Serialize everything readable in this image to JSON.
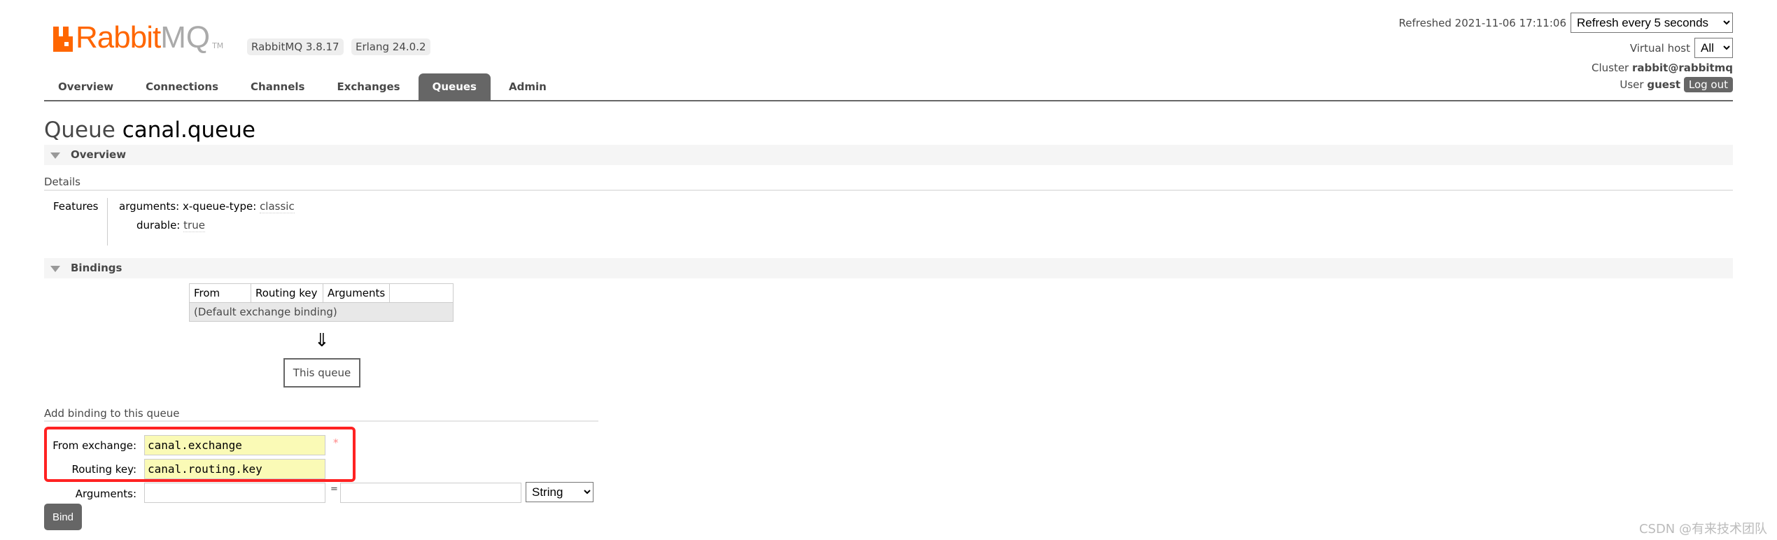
{
  "header": {
    "logo_text": "RabbitMQ",
    "versions": [
      "RabbitMQ 3.8.17",
      "Erlang 24.0.2"
    ],
    "refreshed": "Refreshed 2021-11-06 17:11:06",
    "refresh_select": "Refresh every 5 seconds",
    "vhost_label": "Virtual host",
    "vhost_value": "All",
    "cluster_label": "Cluster",
    "cluster_value": "rabbit@rabbitmq",
    "user_label": "User",
    "user_value": "guest",
    "logout": "Log out",
    "brand_color": "#ff6600"
  },
  "tabs": [
    {
      "label": "Overview"
    },
    {
      "label": "Connections"
    },
    {
      "label": "Channels"
    },
    {
      "label": "Exchanges"
    },
    {
      "label": "Queues",
      "active": true
    },
    {
      "label": "Admin"
    }
  ],
  "page": {
    "title_prefix": "Queue",
    "title_name": "canal.queue"
  },
  "overview": {
    "section": "Overview",
    "details": "Details",
    "features_label": "Features",
    "arguments_key": "arguments:",
    "arg_name": "x-queue-type:",
    "arg_value": "classic",
    "durable_key": "durable:",
    "durable_value": "true"
  },
  "bindings": {
    "section": "Bindings",
    "columns": [
      "From",
      "Routing key",
      "Arguments"
    ],
    "rows": [
      "(Default exchange binding)"
    ],
    "arrow": "⇓",
    "this_queue": "This queue"
  },
  "add_binding": {
    "title": "Add binding to this queue",
    "from_label": "From exchange:",
    "from_value": "canal.exchange",
    "required": "*",
    "routing_label": "Routing key:",
    "routing_value": "canal.routing.key",
    "arguments_label": "Arguments:",
    "equals": "=",
    "type_select": "String",
    "bind": "Bind"
  },
  "watermark": "CSDN @有来技术团队"
}
